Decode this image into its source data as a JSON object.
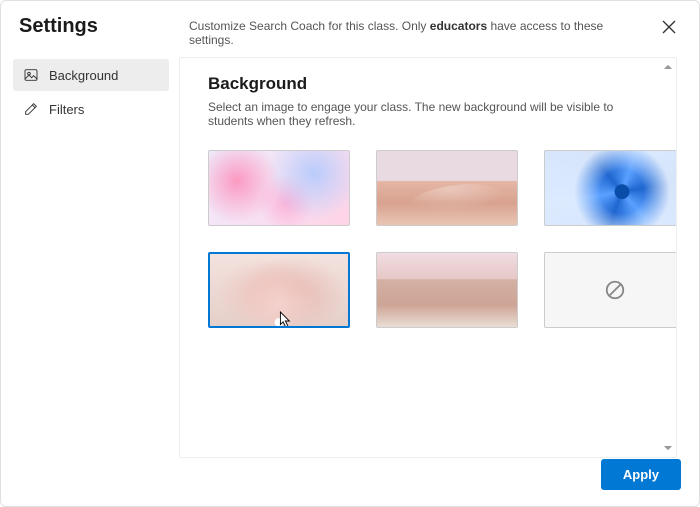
{
  "header": {
    "title": "Settings",
    "subtitle_pre": "Customize Search Coach for this class. Only ",
    "subtitle_bold": "educators",
    "subtitle_post": " have access to these settings."
  },
  "sidebar": {
    "items": [
      {
        "label": "Background",
        "icon": "image-icon",
        "active": true
      },
      {
        "label": "Filters",
        "icon": "pencil-icon",
        "active": false
      }
    ]
  },
  "content": {
    "section_title": "Background",
    "section_desc": "Select an image to engage your class. The new background will be visible to students when they refresh.",
    "thumbs": [
      {
        "name": "background-option-bubbles"
      },
      {
        "name": "background-option-desert"
      },
      {
        "name": "background-option-bloom"
      },
      {
        "name": "background-option-petals",
        "selected": true
      },
      {
        "name": "background-option-dune"
      },
      {
        "name": "background-option-none",
        "none": true
      }
    ]
  },
  "footer": {
    "apply_label": "Apply"
  }
}
